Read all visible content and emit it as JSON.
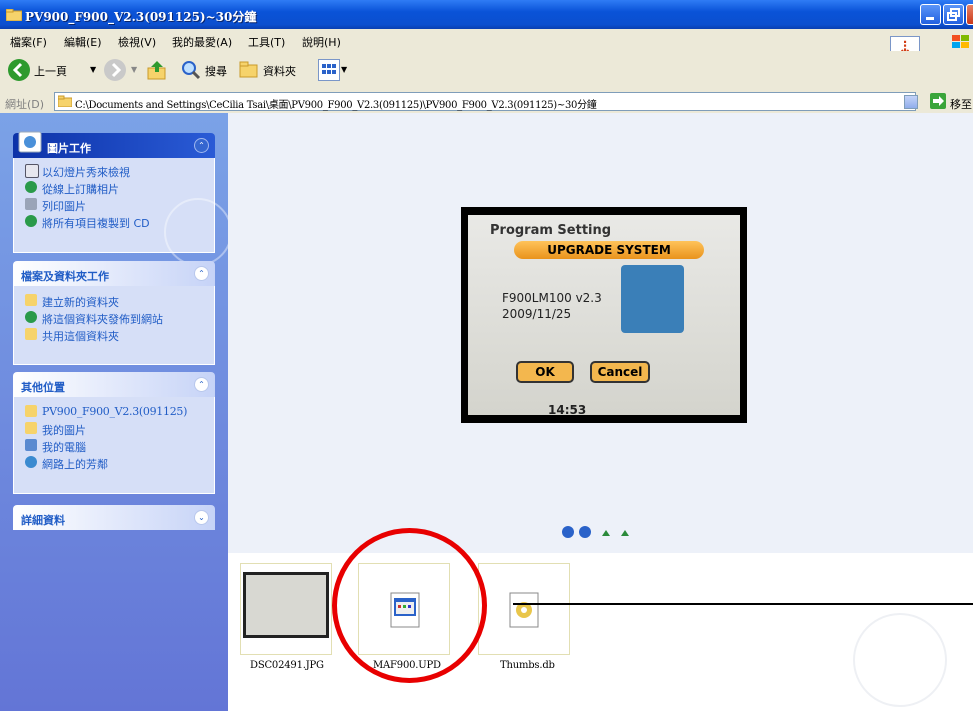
{
  "window": {
    "title": "PV900_F900_V2.3(091125)~30分鐘"
  },
  "menu": {
    "items": [
      "檔案(F)",
      "編輯(E)",
      "檢視(V)",
      "我的最愛(A)",
      "工具(T)",
      "說明(H)"
    ]
  },
  "toolbar": {
    "back_label": "上一頁",
    "search_label": "搜尋",
    "folders_label": "資料夾"
  },
  "address": {
    "label": "網址(D)",
    "path": "C:\\Documents and Settings\\CeCilia Tsai\\桌面\\PV900_F900_V2.3(091125)\\PV900_F900_V2.3(091125)~30分鐘",
    "go_label": "移至"
  },
  "sidebar": {
    "picture_tasks": {
      "title": "圖片工作",
      "items": [
        "以幻燈片秀來檢視",
        "從線上訂購相片",
        "列印圖片",
        "將所有項目複製到 CD"
      ]
    },
    "file_tasks": {
      "title": "檔案及資料夾工作",
      "items": [
        "建立新的資料夾",
        "將這個資料夾發佈到網站",
        "共用這個資料夾"
      ]
    },
    "other_places": {
      "title": "其他位置",
      "items": [
        "PV900_F900_V2.3(091125)",
        "我的圖片",
        "我的電腦",
        "網路上的芳鄰"
      ]
    },
    "details": {
      "title": "詳細資料"
    }
  },
  "preview": {
    "program_setting": "Program Setting",
    "upgrade_system": "UPGRADE SYSTEM",
    "firmware_version": "F900LM100 v2.3",
    "firmware_date": "2009/11/25",
    "ok_label": "OK",
    "cancel_label": "Cancel",
    "clock": "14:53"
  },
  "files": [
    "DSC02491.JPG",
    "MAF900.UPD",
    "Thumbs.db"
  ],
  "colors": {
    "titlebar": "#0b4fcf",
    "sidebar": "#7ba2e7",
    "annotation_circle": "#e80000"
  }
}
